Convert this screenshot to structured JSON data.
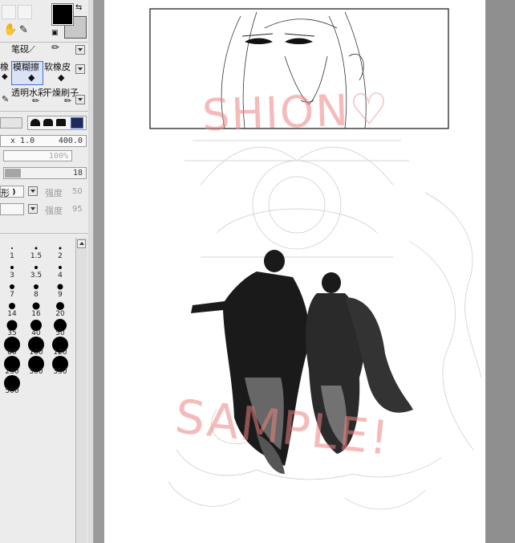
{
  "colors": {
    "foreground": "#000000",
    "background": "#c8c8c8",
    "accent": "#4a6fc4",
    "watermark": "#ec8282"
  },
  "tools": {
    "row1": [
      "笔",
      "砚"
    ],
    "row2": [
      "橡",
      "模糊擦",
      "软橡皮"
    ],
    "row3": [
      "透明水彩",
      "干燥刷子"
    ]
  },
  "zoom": {
    "multiplier": "x 1.0",
    "max": "400.0"
  },
  "opacity": {
    "value": "100%"
  },
  "size_slider": {
    "value": "18"
  },
  "shape_row": {
    "label": "形",
    "strength_label": "强度",
    "strength_value": "50"
  },
  "texture_row": {
    "strength_label": "强度",
    "strength_value": "95"
  },
  "brush_sizes": [
    {
      "label": "1",
      "size": 1
    },
    {
      "label": "1.5",
      "size": 1.5
    },
    {
      "label": "2",
      "size": 2
    },
    {
      "label": "3",
      "size": 3
    },
    {
      "label": "3.5",
      "size": 3.5
    },
    {
      "label": "4",
      "size": 4
    },
    {
      "label": "7",
      "size": 7
    },
    {
      "label": "8",
      "size": 8
    },
    {
      "label": "9",
      "size": 9
    },
    {
      "label": "14",
      "size": 14
    },
    {
      "label": "16",
      "size": 16
    },
    {
      "label": "20",
      "size": 20
    },
    {
      "label": "35",
      "size": 35
    },
    {
      "label": "40",
      "size": 40
    },
    {
      "label": "50",
      "size": 50
    },
    {
      "label": "80",
      "size": 80
    },
    {
      "label": "100",
      "size": 100
    },
    {
      "label": "120",
      "size": 120
    },
    {
      "label": "230",
      "size": 230
    },
    {
      "label": "300",
      "size": 300
    },
    {
      "label": "350",
      "size": 350
    },
    {
      "label": "500",
      "size": 500
    }
  ],
  "watermarks": {
    "top": "SHION♡",
    "bottom": "SAMPLE!"
  }
}
